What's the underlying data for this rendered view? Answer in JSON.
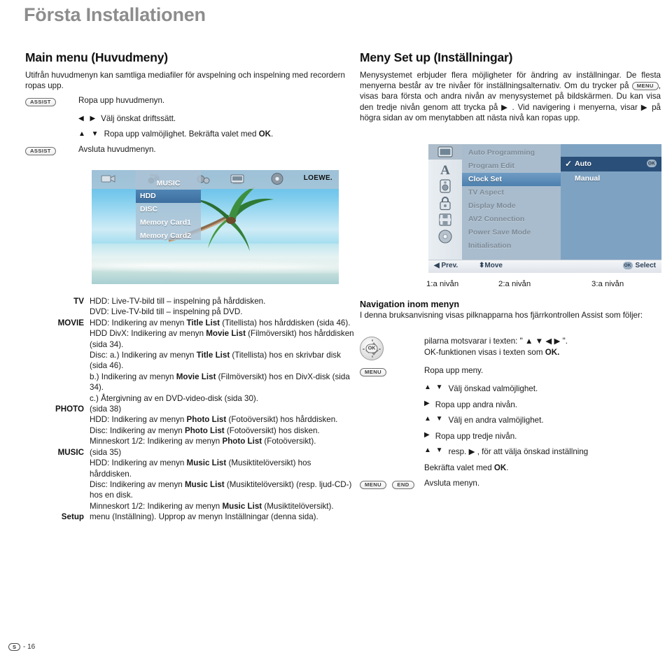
{
  "page": {
    "title": "Första Installationen",
    "footer_badge": "S",
    "footer_page": "- 16"
  },
  "left": {
    "heading": "Main menu (Huvudmeny)",
    "intro": "Utifrån huvudmenyn kan samtliga mediafiler för avspelning och inspelning med recordern ropas upp.",
    "steps": [
      {
        "key": "ASSIST",
        "arrows": "",
        "text": "Ropa upp huvudmenyn."
      },
      {
        "key": "",
        "arrows": "◀  ▶",
        "text": "Välj önskat driftssätt."
      },
      {
        "key": "",
        "arrows": "▲  ▼",
        "text": "Ropa upp valmöjlighet. Bekräfta valet med OK."
      },
      {
        "key": "ASSIST",
        "arrows": "",
        "text": "Avsluta huvudmenyn."
      }
    ],
    "tv_screenshot": {
      "brand": "LOEWE.",
      "menu_title": "MUSIC",
      "top_icons": [
        "camcorder-icon",
        "music-icon",
        "photo-icon",
        "tv-icon",
        "disc-icon"
      ],
      "items": [
        {
          "label": "HDD",
          "selected": true
        },
        {
          "label": "DISC",
          "selected": false
        },
        {
          "label": "Memory Card1",
          "selected": false
        },
        {
          "label": "Memory Card2",
          "selected": false
        }
      ]
    },
    "definitions": [
      {
        "key": "TV",
        "lines": [
          "HDD: Live-TV-bild till – inspelning på hårddisken.",
          "DVD: Live-TV-bild till – inspelning på DVD."
        ]
      },
      {
        "key": "MOVIE",
        "lines": [
          "HDD: Indikering av menyn <b>Title List</b> (Titellista) hos hårddisken (sida 46).",
          "HDD DivX: Indikering av menyn <b>Movie List</b> (Filmöversikt) hos hårddisken (sida 34).",
          "Disc: a.) Indikering av menyn <b>Title List</b> (Titellista) hos en skrivbar disk (sida 46).",
          "b.) Indikering av menyn <b>Movie List</b> (Filmöversikt) hos en DivX-disk (sida 34).",
          "c.) Återgivning av en DVD-video-disk (sida 30)."
        ]
      },
      {
        "key": "PHOTO",
        "lines": [
          "(sida 38)",
          "HDD: Indikering av menyn <b>Photo List</b> (Fotoöversikt) hos hårddisken.",
          "Disc: Indikering av menyn <b>Photo List</b> (Fotoöversikt) hos disken.",
          "Minneskort 1/2: Indikering av menyn <b>Photo List</b> (Fotoöversikt)."
        ]
      },
      {
        "key": "MUSIC",
        "lines": [
          "(sida 35)",
          "HDD: Indikering av menyn <b>Music List</b> (Musiktitelöversikt) hos hårddisken.",
          "Disc: Indikering av menyn <b>Music List</b> (Musiktitelöversikt) (resp. ljud-CD-) hos en disk.",
          "Minneskort 1/2: Indikering av menyn <b>Music List</b> (Musiktitelöversikt)."
        ]
      },
      {
        "key": "Setup",
        "lines": [
          "menu (Inställning). Upprop av menyn Inställningar (denna sida)."
        ]
      }
    ]
  },
  "right": {
    "heading": "Meny Set up (Inställningar)",
    "intro_1": "Menysystemet erbjuder flera möjligheter för ändring av inställningar. De flesta menyerna består av tre nivåer för inställningsalternativ. Om du trycker på ",
    "intro_key": "MENU",
    "intro_2": ", visas bara första och andra nivån av menysystemet på bildskärmen. Du kan visa den tredje nivån genom att trycka på ▶ . Vid navigering i menyerna, visar ▶ på högra sidan av om menytabben att nästa nivå kan ropas upp.",
    "settings_screenshot": {
      "icons": [
        "tv-icon",
        "language-icon",
        "audio-icon",
        "lock-icon",
        "recording-icon",
        "disc-icon"
      ],
      "level1_items": [
        {
          "label": "Auto Programming",
          "selected": false
        },
        {
          "label": "Program Edit",
          "selected": false
        },
        {
          "label": "Clock Set",
          "selected": true
        },
        {
          "label": "TV Aspect",
          "selected": false
        },
        {
          "label": "Display Mode",
          "selected": false
        },
        {
          "label": "AV2 Connection",
          "selected": false
        },
        {
          "label": "Power Save Mode",
          "selected": false
        },
        {
          "label": "Initialisation",
          "selected": false
        }
      ],
      "level3_options": [
        {
          "label": "Auto",
          "selected": true,
          "checked": true,
          "ok_badge": "OK"
        },
        {
          "label": "Manual",
          "selected": false,
          "checked": false,
          "ok_badge": ""
        }
      ],
      "statusbar": {
        "prev": "Prev.",
        "move": "Move",
        "select": "Select",
        "ok_badge": "OK"
      }
    },
    "levels": [
      "1:a nivån",
      "2:a nivån",
      "3:a nivån"
    ],
    "nav_heading": "Navigation inom menyn",
    "nav_intro": "I denna bruksanvisning visas pilknapparna hos fjärrkontrollen Assist som följer:",
    "nav_rows": [
      {
        "key": "remote",
        "arrows": "",
        "text": "pilarna motsvarar i texten: \" ▲  ▼  ◀  ▶ \"."
      },
      {
        "key": "",
        "arrows": "",
        "text": "OK-funktionen visas i texten som OK."
      },
      {
        "key": "MENU",
        "arrows": "",
        "text": "Ropa upp meny."
      },
      {
        "key": "",
        "arrows": "▲  ▼",
        "text": "Välj önskad valmöjlighet."
      },
      {
        "key": "",
        "arrows": "▶",
        "text": "Ropa upp andra nivån."
      },
      {
        "key": "",
        "arrows": "▲  ▼",
        "text": "Välj en andra valmöjlighet."
      },
      {
        "key": "",
        "arrows": "▶",
        "text": "Ropa upp tredje nivån."
      },
      {
        "key": "",
        "arrows": "▲  ▼",
        "text": "resp. ▶ , för att välja önskad inställning"
      },
      {
        "key": "",
        "arrows": "",
        "text": "Bekräfta valet med OK."
      },
      {
        "key": "MENU+END",
        "arrows": "",
        "text": "Avsluta menyn."
      }
    ],
    "nav_keys": {
      "menu": "MENU",
      "end": "END",
      "ok": "OK"
    }
  },
  "colors": {
    "title_gray": "#8d8d8d",
    "menu_selected_blue": "#4d80ae",
    "option_selected_navy": "#2a4f78",
    "panel_blue": "#7ea2c2"
  }
}
